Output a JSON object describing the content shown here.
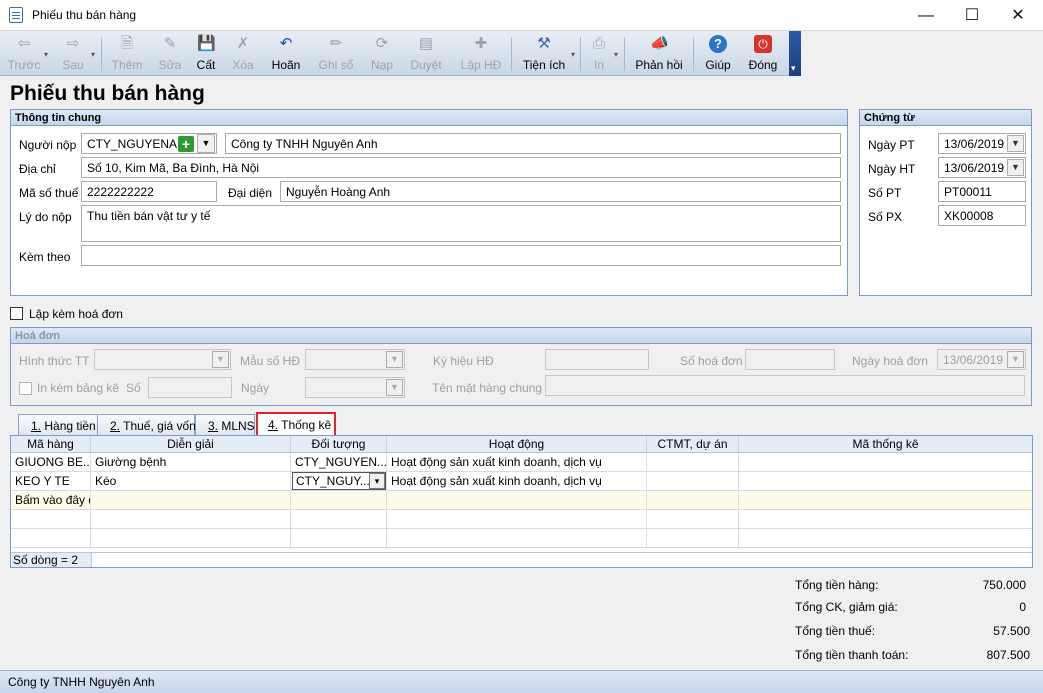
{
  "window": {
    "title": "Phiếu thu bán hàng",
    "minimize": "—",
    "maximize": "☐",
    "close": "✕"
  },
  "toolbar": [
    {
      "label": "Trước",
      "icon": "arrow-left-icon",
      "glyph": "⇦",
      "disabled": true
    },
    {
      "label": "Sau",
      "icon": "arrow-right-icon",
      "glyph": "⇨",
      "disabled": true
    },
    {
      "label": "Thêm",
      "icon": "new-document-icon",
      "glyph": "🗎",
      "disabled": true
    },
    {
      "label": "Sửa",
      "icon": "edit-document-icon",
      "glyph": "✎",
      "disabled": true
    },
    {
      "label": "Cất",
      "icon": "save-icon",
      "glyph": "💾",
      "disabled": false
    },
    {
      "label": "Xóa",
      "icon": "delete-icon",
      "glyph": "✗",
      "disabled": true
    },
    {
      "label": "Hoãn",
      "icon": "undo-icon",
      "glyph": "↶",
      "disabled": false
    },
    {
      "label": "Ghi sổ",
      "icon": "pencil-icon",
      "glyph": "✏",
      "disabled": true
    },
    {
      "label": "Nạp",
      "icon": "reload-icon",
      "glyph": "⟳",
      "disabled": true
    },
    {
      "label": "Duyệt",
      "icon": "approve-icon",
      "glyph": "▤",
      "disabled": true
    },
    {
      "label": "Lập HĐ",
      "icon": "create-invoice-icon",
      "glyph": "✚",
      "disabled": true
    },
    {
      "label": "Tiện ích",
      "icon": "tools-icon",
      "glyph": "⚒",
      "disabled": false
    },
    {
      "label": "In",
      "icon": "printer-icon",
      "glyph": "⎙",
      "disabled": true
    },
    {
      "label": "Phản hồi",
      "icon": "megaphone-icon",
      "glyph": "📣",
      "disabled": false
    },
    {
      "label": "Giúp",
      "icon": "help-icon",
      "glyph": "?",
      "disabled": false
    },
    {
      "label": "Đóng",
      "icon": "power-icon",
      "glyph": "⏻",
      "disabled": false
    }
  ],
  "page_title": "Phiếu thu bán hàng",
  "general": {
    "header": "Thông tin chung",
    "payer_label": "Người nộp",
    "payer_code": "CTY_NGUYENAN",
    "payer_name": "Công ty TNHH Nguyên Anh",
    "address_label": "Địa chỉ",
    "address": "Số 10, Kim Mã, Ba Đình, Hà Nội",
    "tax_label": "Mã số thuế",
    "tax": "2222222222",
    "rep_label": "Đại diện",
    "rep": "Nguyễn Hoàng Anh",
    "reason_label": "Lý do nộp",
    "reason": "Thu tiền bán vật tư y tế",
    "attach_label": "Kèm theo",
    "attach": ""
  },
  "voucher": {
    "header": "Chứng từ",
    "date_pt_label": "Ngày PT",
    "date_pt": "13/06/2019",
    "date_ht_label": "Ngày HT",
    "date_ht": "13/06/2019",
    "so_pt_label": "Số PT",
    "so_pt": "PT00011",
    "so_px_label": "Số PX",
    "so_px": "XK00008"
  },
  "with_invoice_label": "Lập kèm hoá đơn",
  "invoice": {
    "header": "Hoá đơn",
    "form_label": "Hình thức TT",
    "template_label": "Mẫu số HĐ",
    "symbol_label": "Ký hiệu HĐ",
    "number_label": "Số hoá đơn",
    "date_label": "Ngày hoá đơn",
    "date": "13/06/2019",
    "print_list_label": "In kèm bảng kê",
    "so_label": "Số",
    "ngay_label": "Ngày",
    "item_name_label": "Tên mặt hàng chung"
  },
  "tabs": [
    {
      "num": "1.",
      "label": " Hàng tiền"
    },
    {
      "num": "2.",
      "label": " Thuế, giá vốn"
    },
    {
      "num": "3.",
      "label": " MLNS"
    },
    {
      "num": "4.",
      "label": " Thống kê"
    }
  ],
  "grid": {
    "columns": [
      "Mã hàng",
      "Diễn giải",
      "Đối tượng",
      "Hoạt động",
      "CTMT, dự án",
      "Mã thống kê"
    ],
    "rows": [
      [
        "GIUONG BE...",
        "Giường bệnh",
        "CTY_NGUYEN...",
        "Hoạt động sản xuất kinh doanh, dịch vụ",
        "",
        ""
      ],
      [
        "KEO Y TE",
        "Kéo",
        "CTY_NGUY...",
        "Hoạt động sản xuất kinh doanh, dịch vụ",
        "",
        ""
      ]
    ],
    "new_row": "Bấm vào đây để thêm mới",
    "row_count": "Số dòng = 2"
  },
  "totals": [
    {
      "label": "Tổng tiền hàng:",
      "value": "750.000"
    },
    {
      "label": "Tổng CK, giảm giá:",
      "value": "0"
    },
    {
      "label": "Tổng tiền thuế:",
      "value": "57.500"
    },
    {
      "label": "Tổng tiền thanh toán:",
      "value": "807.500"
    }
  ],
  "status_bar": "Công ty TNHH Nguyên Anh",
  "colors": {
    "accent": "#2b5aa8",
    "tab_highlight": "#e0262d",
    "new_row": "#fefce8"
  }
}
